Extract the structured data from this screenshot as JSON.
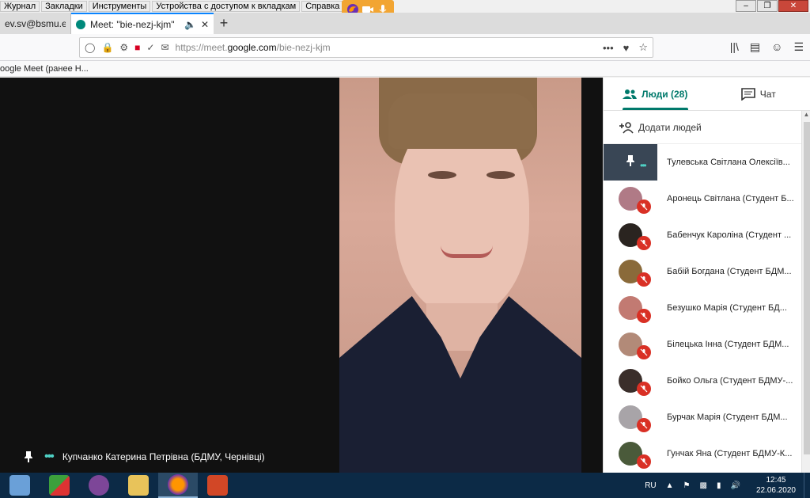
{
  "menubar": {
    "items": [
      "Журнал",
      "Закладки",
      "Инструменты",
      "Устройства с доступом к вкладкам",
      "Справка"
    ],
    "underline_letters": [
      "Ж",
      "З",
      "И",
      "У",
      "С"
    ]
  },
  "tabs": [
    {
      "label": "ev.sv@bsmu.ed",
      "active": false
    },
    {
      "label": "Meet: \"bie-nezj-kjm\"",
      "active": true
    }
  ],
  "navbar": {
    "url_prefix": "https://meet.",
    "url_domain": "google.com",
    "url_path": "/bie-nezj-kjm",
    "more_icon": "•••"
  },
  "bookmarks": {
    "item": "oogle Meet (ранее H..."
  },
  "video": {
    "speaker_name": "Купчанко Катерина Петрівна (БДМУ, Чернівці)"
  },
  "panel": {
    "people_tab": "Люди (28)",
    "chat_tab": "Чат",
    "add_people": "Додати людей",
    "participants": [
      {
        "name": "Тулевська Світлана Олексіїв...",
        "avatar_color": "#8a7a6a",
        "muted": false
      },
      {
        "name": "Аронець Світлана (Студент Б...",
        "avatar_color": "#b07a86",
        "muted": true
      },
      {
        "name": "Бабенчук Кароліна (Студент ...",
        "avatar_color": "#2a2420",
        "muted": true
      },
      {
        "name": "Бабій Богдана (Студент БДМ...",
        "avatar_color": "#8a6a3a",
        "muted": true
      },
      {
        "name": "Безушко Марія (Студент БД...",
        "avatar_color": "#c27a72",
        "muted": true
      },
      {
        "name": "Білецька Інна (Студент БДМ...",
        "avatar_color": "#b28a78",
        "muted": true
      },
      {
        "name": "Бойко Ольга (Студент БДМУ-...",
        "avatar_color": "#3a2e2a",
        "muted": true
      },
      {
        "name": "Бурчак Марія (Студент БДМ...",
        "avatar_color": "#a8a4a8",
        "muted": true
      },
      {
        "name": "Гунчак Яна (Студент БДМУ-К...",
        "avatar_color": "#4a5a3a",
        "muted": true
      }
    ]
  },
  "taskbar": {
    "lang": "RU",
    "time": "12:45",
    "date": "22.06.2020"
  },
  "colors": {
    "accent": "#00796b",
    "mute": "#d93025",
    "taskbar": "#0c2a46",
    "mic_overlay": "#f2a532"
  }
}
